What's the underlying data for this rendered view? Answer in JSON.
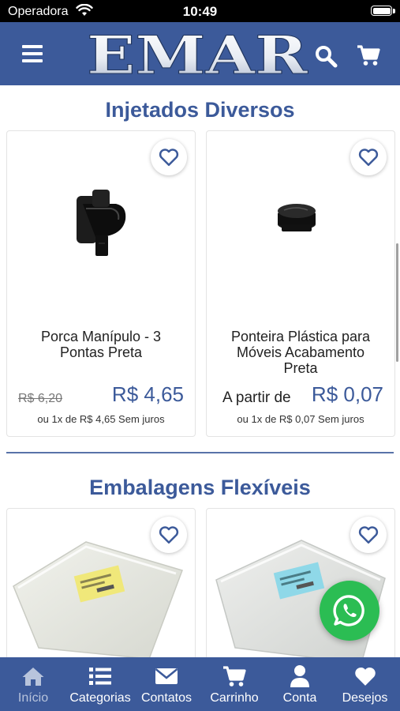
{
  "status_bar": {
    "carrier": "Operadora",
    "time": "10:49"
  },
  "header": {
    "logo_text": "EMAR"
  },
  "sections": [
    {
      "title": "Injetados Diversos",
      "products": [
        {
          "name_lines": [
            "Porca Manípulo - 3",
            "Pontas Preta"
          ],
          "old_price": "R$ 6,20",
          "price": "R$ 4,65",
          "installments": "ou 1x de R$ 4,65 Sem juros"
        },
        {
          "name_lines": [
            "Ponteira Plástica para",
            "Móveis Acabamento",
            "Preta"
          ],
          "price_prefix": "A partir de",
          "price": "R$ 0,07",
          "installments": "ou 1x de R$ 0,07 Sem juros"
        }
      ]
    },
    {
      "title": "Embalagens Flexíveis"
    }
  ],
  "tabs": [
    {
      "label": "Início",
      "icon": "home-icon",
      "active": true
    },
    {
      "label": "Categorias",
      "icon": "list-icon"
    },
    {
      "label": "Contatos",
      "icon": "envelope-icon"
    },
    {
      "label": "Carrinho",
      "icon": "cart-icon"
    },
    {
      "label": "Conta",
      "icon": "user-icon"
    },
    {
      "label": "Desejos",
      "icon": "heart-icon"
    }
  ],
  "colors": {
    "brand": "#3c5a9a",
    "whatsapp": "#2bbd53",
    "heart_outline": "#3c5a9a"
  }
}
